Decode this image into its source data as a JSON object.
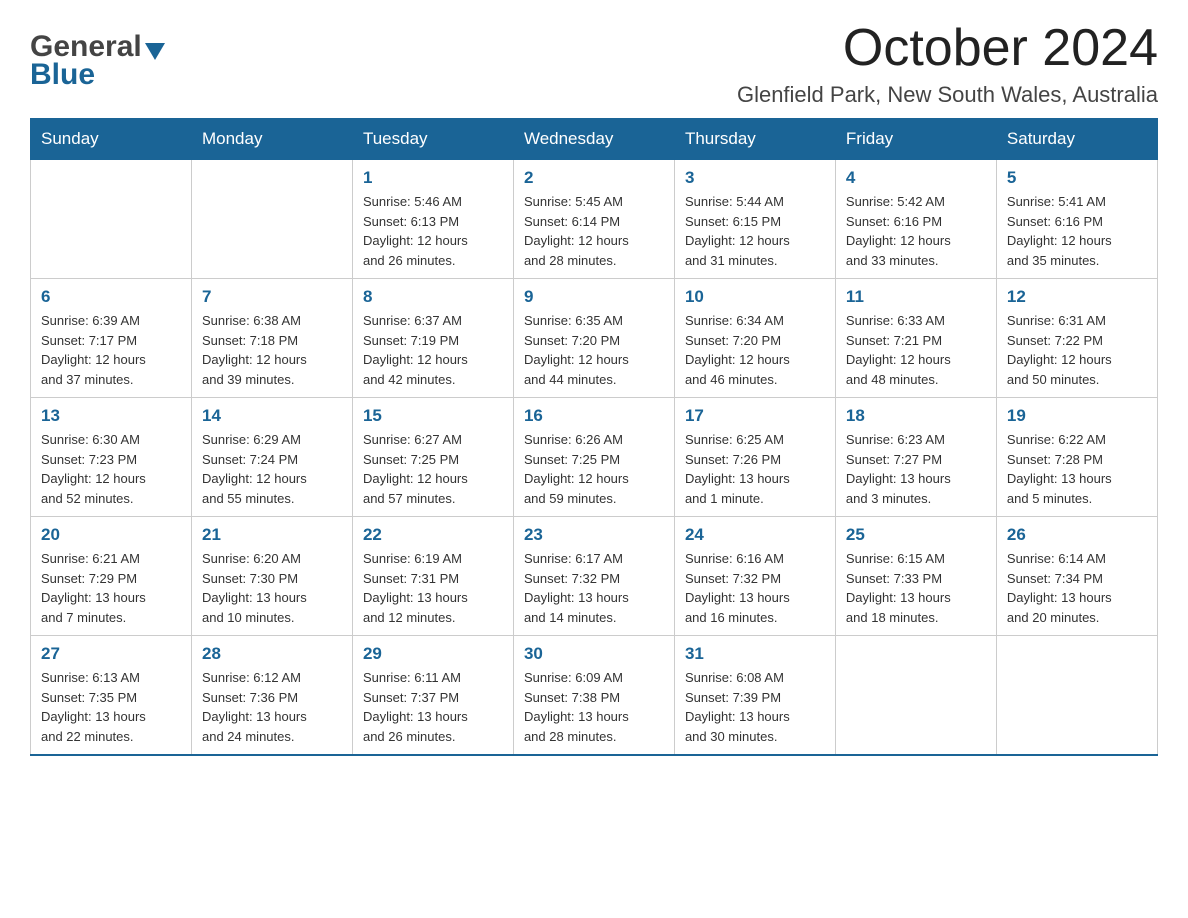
{
  "header": {
    "logo_general": "General",
    "logo_blue": "Blue",
    "month": "October 2024",
    "location": "Glenfield Park, New South Wales, Australia"
  },
  "weekdays": [
    "Sunday",
    "Monday",
    "Tuesday",
    "Wednesday",
    "Thursday",
    "Friday",
    "Saturday"
  ],
  "weeks": [
    [
      {
        "day": "",
        "info": ""
      },
      {
        "day": "",
        "info": ""
      },
      {
        "day": "1",
        "info": "Sunrise: 5:46 AM\nSunset: 6:13 PM\nDaylight: 12 hours\nand 26 minutes."
      },
      {
        "day": "2",
        "info": "Sunrise: 5:45 AM\nSunset: 6:14 PM\nDaylight: 12 hours\nand 28 minutes."
      },
      {
        "day": "3",
        "info": "Sunrise: 5:44 AM\nSunset: 6:15 PM\nDaylight: 12 hours\nand 31 minutes."
      },
      {
        "day": "4",
        "info": "Sunrise: 5:42 AM\nSunset: 6:16 PM\nDaylight: 12 hours\nand 33 minutes."
      },
      {
        "day": "5",
        "info": "Sunrise: 5:41 AM\nSunset: 6:16 PM\nDaylight: 12 hours\nand 35 minutes."
      }
    ],
    [
      {
        "day": "6",
        "info": "Sunrise: 6:39 AM\nSunset: 7:17 PM\nDaylight: 12 hours\nand 37 minutes."
      },
      {
        "day": "7",
        "info": "Sunrise: 6:38 AM\nSunset: 7:18 PM\nDaylight: 12 hours\nand 39 minutes."
      },
      {
        "day": "8",
        "info": "Sunrise: 6:37 AM\nSunset: 7:19 PM\nDaylight: 12 hours\nand 42 minutes."
      },
      {
        "day": "9",
        "info": "Sunrise: 6:35 AM\nSunset: 7:20 PM\nDaylight: 12 hours\nand 44 minutes."
      },
      {
        "day": "10",
        "info": "Sunrise: 6:34 AM\nSunset: 7:20 PM\nDaylight: 12 hours\nand 46 minutes."
      },
      {
        "day": "11",
        "info": "Sunrise: 6:33 AM\nSunset: 7:21 PM\nDaylight: 12 hours\nand 48 minutes."
      },
      {
        "day": "12",
        "info": "Sunrise: 6:31 AM\nSunset: 7:22 PM\nDaylight: 12 hours\nand 50 minutes."
      }
    ],
    [
      {
        "day": "13",
        "info": "Sunrise: 6:30 AM\nSunset: 7:23 PM\nDaylight: 12 hours\nand 52 minutes."
      },
      {
        "day": "14",
        "info": "Sunrise: 6:29 AM\nSunset: 7:24 PM\nDaylight: 12 hours\nand 55 minutes."
      },
      {
        "day": "15",
        "info": "Sunrise: 6:27 AM\nSunset: 7:25 PM\nDaylight: 12 hours\nand 57 minutes."
      },
      {
        "day": "16",
        "info": "Sunrise: 6:26 AM\nSunset: 7:25 PM\nDaylight: 12 hours\nand 59 minutes."
      },
      {
        "day": "17",
        "info": "Sunrise: 6:25 AM\nSunset: 7:26 PM\nDaylight: 13 hours\nand 1 minute."
      },
      {
        "day": "18",
        "info": "Sunrise: 6:23 AM\nSunset: 7:27 PM\nDaylight: 13 hours\nand 3 minutes."
      },
      {
        "day": "19",
        "info": "Sunrise: 6:22 AM\nSunset: 7:28 PM\nDaylight: 13 hours\nand 5 minutes."
      }
    ],
    [
      {
        "day": "20",
        "info": "Sunrise: 6:21 AM\nSunset: 7:29 PM\nDaylight: 13 hours\nand 7 minutes."
      },
      {
        "day": "21",
        "info": "Sunrise: 6:20 AM\nSunset: 7:30 PM\nDaylight: 13 hours\nand 10 minutes."
      },
      {
        "day": "22",
        "info": "Sunrise: 6:19 AM\nSunset: 7:31 PM\nDaylight: 13 hours\nand 12 minutes."
      },
      {
        "day": "23",
        "info": "Sunrise: 6:17 AM\nSunset: 7:32 PM\nDaylight: 13 hours\nand 14 minutes."
      },
      {
        "day": "24",
        "info": "Sunrise: 6:16 AM\nSunset: 7:32 PM\nDaylight: 13 hours\nand 16 minutes."
      },
      {
        "day": "25",
        "info": "Sunrise: 6:15 AM\nSunset: 7:33 PM\nDaylight: 13 hours\nand 18 minutes."
      },
      {
        "day": "26",
        "info": "Sunrise: 6:14 AM\nSunset: 7:34 PM\nDaylight: 13 hours\nand 20 minutes."
      }
    ],
    [
      {
        "day": "27",
        "info": "Sunrise: 6:13 AM\nSunset: 7:35 PM\nDaylight: 13 hours\nand 22 minutes."
      },
      {
        "day": "28",
        "info": "Sunrise: 6:12 AM\nSunset: 7:36 PM\nDaylight: 13 hours\nand 24 minutes."
      },
      {
        "day": "29",
        "info": "Sunrise: 6:11 AM\nSunset: 7:37 PM\nDaylight: 13 hours\nand 26 minutes."
      },
      {
        "day": "30",
        "info": "Sunrise: 6:09 AM\nSunset: 7:38 PM\nDaylight: 13 hours\nand 28 minutes."
      },
      {
        "day": "31",
        "info": "Sunrise: 6:08 AM\nSunset: 7:39 PM\nDaylight: 13 hours\nand 30 minutes."
      },
      {
        "day": "",
        "info": ""
      },
      {
        "day": "",
        "info": ""
      }
    ]
  ]
}
